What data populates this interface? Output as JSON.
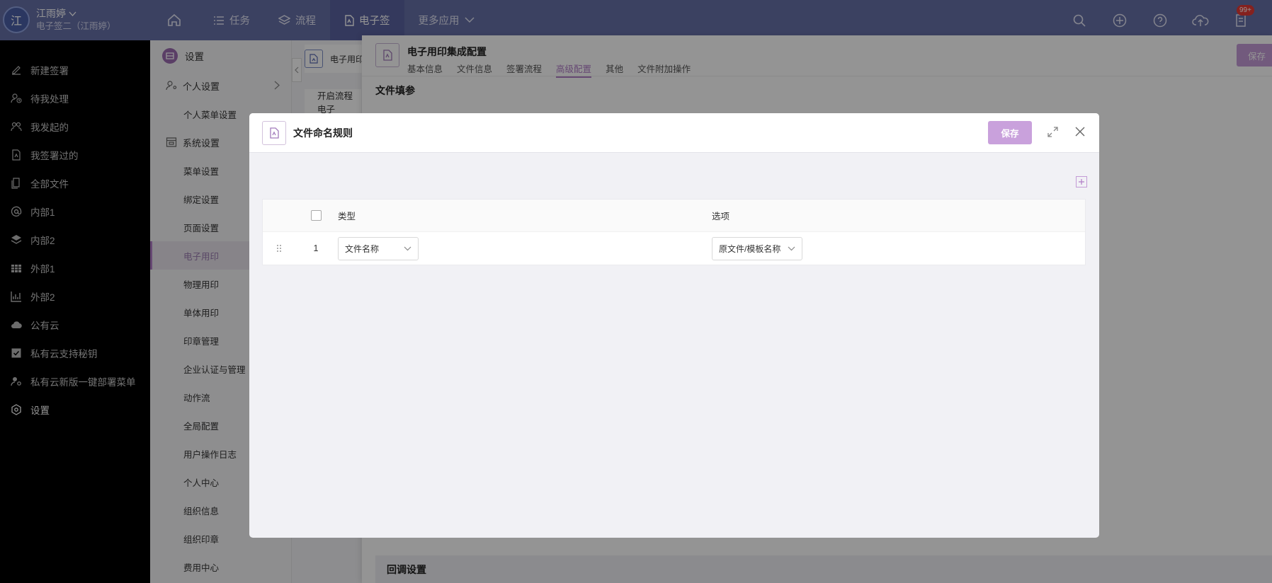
{
  "user": {
    "avatar": "江",
    "name": "江雨婷",
    "sub": "电子签二（江雨婷）"
  },
  "topnav": {
    "tasks": "任务",
    "flow": "流程",
    "esign": "电子签",
    "more": "更多应用"
  },
  "notifications": {
    "badge": "99+"
  },
  "sidebar": {
    "items": [
      {
        "label": "新建签署",
        "icon": "pen-icon"
      },
      {
        "label": "待我处理",
        "icon": "user-clock-icon"
      },
      {
        "label": "我发起的",
        "icon": "users-icon"
      },
      {
        "label": "我签署过的",
        "icon": "doc-sign-icon"
      },
      {
        "label": "全部文件",
        "icon": "files-icon"
      },
      {
        "label": "内部1",
        "icon": "at-icon"
      },
      {
        "label": "内部2",
        "icon": "layers-icon"
      },
      {
        "label": "外部1",
        "icon": "table-icon"
      },
      {
        "label": "外部2",
        "icon": "bar-chart-icon"
      },
      {
        "label": "公有云",
        "icon": "cloud-icon"
      },
      {
        "label": "私有云支持秘钥",
        "icon": "check-square-icon"
      },
      {
        "label": "私有云新版一键部署菜单",
        "icon": "user-gear-icon"
      },
      {
        "label": "设置",
        "icon": "hexagon-gear-icon"
      }
    ]
  },
  "settings_menu": {
    "title": "设置",
    "personal_group": "个人设置",
    "personal_menu": "个人菜单设置",
    "system_group": "系统设置",
    "subs": [
      "菜单设置",
      "绑定设置",
      "页面设置",
      "电子用印",
      "物理用印",
      "单体用印",
      "印章管理",
      "企业认证与管理",
      "动作流",
      "全局配置",
      "用户操作日志",
      "个人中心",
      "组织信息",
      "组织印章",
      "费用中心"
    ],
    "active": "电子用印"
  },
  "back": {
    "tab_label": "电子用印",
    "button": "开启流程电子"
  },
  "drawer": {
    "title": "电子用印集成配置",
    "tabs": [
      "基本信息",
      "文件信息",
      "签署流程",
      "高级配置",
      "其他",
      "文件附加操作"
    ],
    "active_tab": "高级配置",
    "save": "保存",
    "section1": "文件填参",
    "section2": "回调设置"
  },
  "modal": {
    "title": "文件命名规则",
    "save": "保存",
    "columns": {
      "type": "类型",
      "option": "选项"
    },
    "rows": [
      {
        "index": "1",
        "type": "文件名称",
        "option": "原文件/模板名称"
      }
    ]
  },
  "colors": {
    "topbar": "#6770a8",
    "accent": "#b07cc6",
    "sidebar": "#000000"
  }
}
